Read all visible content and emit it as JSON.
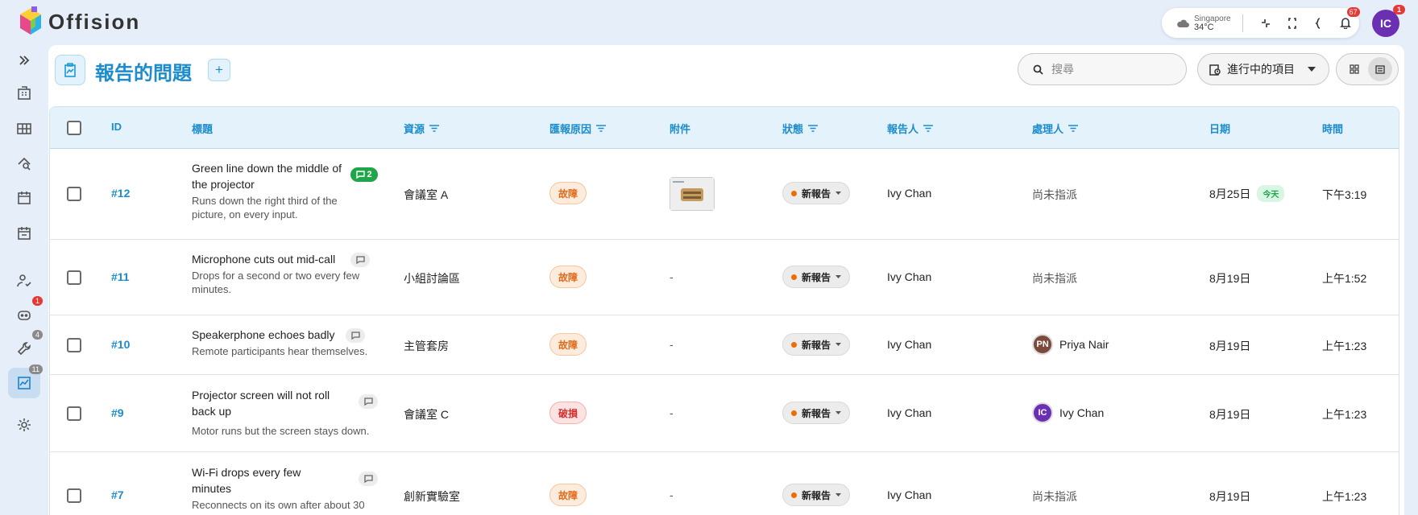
{
  "app": {
    "name": "Offision"
  },
  "topbar": {
    "weather_city": "Singapore",
    "weather_temp": "34°C",
    "notifications_count": "67",
    "avatar_initials": "IC",
    "avatar_badge": "1"
  },
  "sidebar": {
    "badges": {
      "chat": "1",
      "maintenance": "4",
      "reports": "11"
    }
  },
  "page": {
    "title": "報告的問題",
    "add_label": "+",
    "search_placeholder": "搜尋",
    "filter_label": "進行中的項目"
  },
  "table": {
    "headers": {
      "id": "ID",
      "title": "標題",
      "resource": "資源",
      "reason": "匯報原因",
      "attachment": "附件",
      "status": "狀態",
      "reporter": "報告人",
      "assignee": "處理人",
      "date": "日期",
      "time": "時間"
    },
    "rows": [
      {
        "id": "#12",
        "title": "Green line down the middle of the projector",
        "desc": "Runs down the right third of the picture, on every input.",
        "comments": "2",
        "resource": "會議室 A",
        "reason": "故障",
        "attachment": "",
        "status": "新報告",
        "reporter": "Ivy Chan",
        "assignee": "尚未指派",
        "date": "8月25日",
        "today": "今天",
        "time": "下午3:19"
      },
      {
        "id": "#11",
        "title": "Microphone cuts out mid-call",
        "desc": "Drops for a second or two every few minutes.",
        "resource": "小組討論區",
        "reason": "故障",
        "attachment": "-",
        "status": "新報告",
        "reporter": "Ivy Chan",
        "assignee": "尚未指派",
        "date": "8月19日",
        "time": "上午1:52"
      },
      {
        "id": "#10",
        "title": "Speakerphone echoes badly",
        "desc": "Remote participants hear themselves.",
        "resource": "主管套房",
        "reason": "故障",
        "attachment": "-",
        "status": "新報告",
        "reporter": "Ivy Chan",
        "assignee_initials": "PN",
        "assignee": "Priya Nair",
        "date": "8月19日",
        "time": "上午1:23"
      },
      {
        "id": "#9",
        "title": "Projector screen will not roll back up",
        "desc": "Motor runs but the screen stays down.",
        "resource": "會議室 C",
        "reason": "破損",
        "attachment": "-",
        "status": "新報告",
        "reporter": "Ivy Chan",
        "assignee_initials": "IC",
        "assignee": "Ivy Chan",
        "date": "8月19日",
        "time": "上午1:23"
      },
      {
        "id": "#7",
        "title": "Wi-Fi drops every few minutes",
        "desc": "Reconnects on its own after about 30",
        "resource": "創新實驗室",
        "reason": "故障",
        "attachment": "-",
        "status": "新報告",
        "reporter": "Ivy Chan",
        "assignee": "尚未指派",
        "date": "8月19日",
        "time": "上午1:23"
      }
    ]
  },
  "colors": {
    "accent": "#1c8ccc",
    "brand_purple": "#6b2fb4",
    "faulty": "#e26a1c",
    "damaged": "#d32f2f"
  }
}
